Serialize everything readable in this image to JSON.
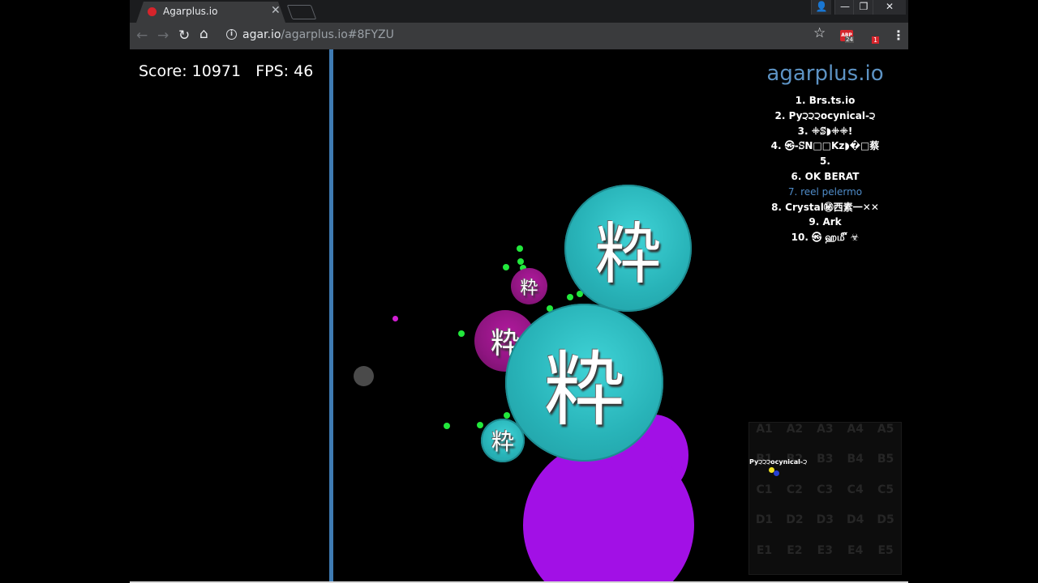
{
  "browser": {
    "tab_title": "Agarplus.io",
    "tab_close": "✕",
    "url_host": "agar.io",
    "url_path": "/agarplus.io#8FYZU",
    "window_controls": [
      "👤",
      "—",
      "❐",
      "✕"
    ],
    "nav": {
      "back": "←",
      "forward": "→",
      "reload": "↻",
      "home": "⌂"
    },
    "star_icon": "☆",
    "ext_abp_label": "ABP",
    "ext_abp_badge": "24",
    "ext_red_badge": "1",
    "menu_icon": "⋮"
  },
  "hud": {
    "score_fps": "Score: 10971   FPS: 46"
  },
  "leaderboard": {
    "title": "agarplus.io",
    "entries": [
      "1. Brs.ts.io",
      "2. Py੨੨੨ocynical-੨",
      "3. ꔰꕷ◗ꔰꔰ!",
      "4. ㉿-ꕶN□□Kz◗�□蔡",
      "5.",
      "6. OK BERAT",
      "7. reel pelermo",
      "8. Crystal㊙西素一✕✕",
      "9. Ark",
      "10. ㉿ ஹ௴ ☣"
    ],
    "highlight_index": 6,
    "highlight_color": "#4f8cc9"
  },
  "skin_glyph": "粋",
  "minimap": {
    "cells": [
      "A1",
      "A2",
      "A3",
      "A4",
      "A5",
      "B1",
      "B2",
      "B3",
      "B4",
      "B5",
      "C1",
      "C2",
      "C3",
      "C4",
      "C5",
      "D1",
      "D2",
      "D3",
      "D4",
      "D5",
      "E1",
      "E2",
      "E3",
      "E4",
      "E5"
    ],
    "player_label": "Py੨੨੨ocynical-੨"
  },
  "colors": {
    "teal_cell": "#28b3b8",
    "purple_skin_cell": "#8e1580",
    "violet_cell": "#a210e6",
    "pellet": "#22e83c",
    "border_line": "#3f7bb3"
  }
}
